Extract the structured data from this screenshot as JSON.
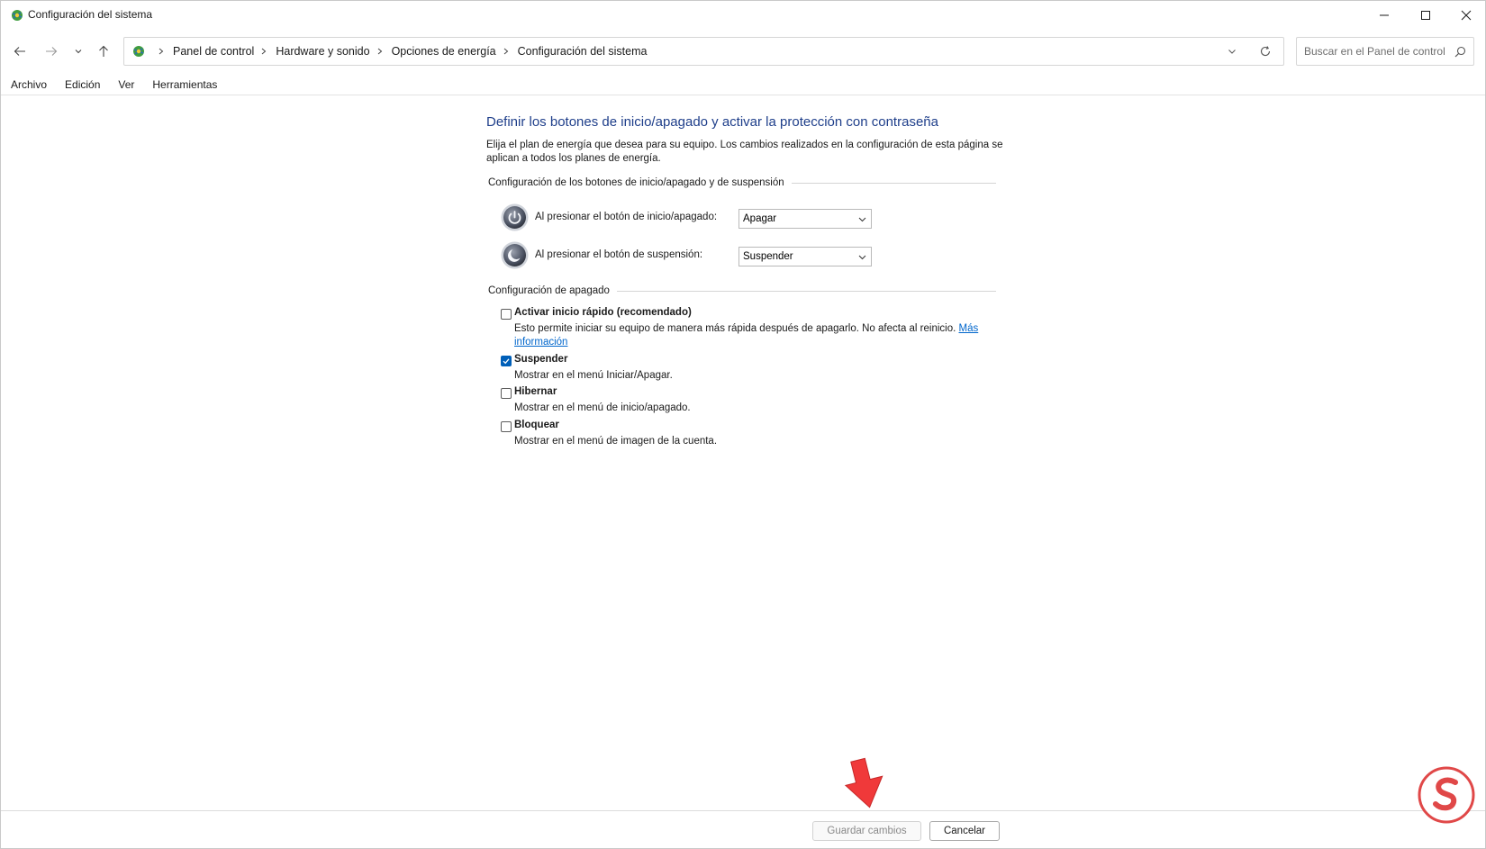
{
  "window": {
    "title": "Configuración del sistema"
  },
  "address_bar": {
    "crumbs": [
      "Panel de control",
      "Hardware y sonido",
      "Opciones de energía",
      "Configuración del sistema"
    ]
  },
  "search": {
    "placeholder": "Buscar en el Panel de control"
  },
  "menu": {
    "items": [
      "Archivo",
      "Edición",
      "Ver",
      "Herramientas"
    ]
  },
  "content": {
    "title": "Definir los botones de inicio/apagado y activar la protección con contraseña",
    "description": "Elija el plan de energía que desea para su equipo. Los cambios realizados en la configuración de esta página se aplican a todos los planes de energía.",
    "buttons_group": {
      "heading": "Configuración de los botones de inicio/apagado y de suspensión",
      "rows": [
        {
          "label": "Al presionar el botón de inicio/apagado:",
          "value": "Apagar"
        },
        {
          "label": "Al presionar el botón de suspensión:",
          "value": "Suspender"
        }
      ]
    },
    "shutdown_group": {
      "heading": "Configuración de apagado",
      "options": [
        {
          "title": "Activar inicio rápido (recomendado)",
          "description": "Esto permite iniciar su equipo de manera más rápida después de apagarlo. No afecta al reinicio.",
          "link": "Más información",
          "checked": false
        },
        {
          "title": "Suspender",
          "description": "Mostrar en el menú Iniciar/Apagar.",
          "checked": true
        },
        {
          "title": "Hibernar",
          "description": "Mostrar en el menú de inicio/apagado.",
          "checked": false
        },
        {
          "title": "Bloquear",
          "description": "Mostrar en el menú de imagen de la cuenta.",
          "checked": false
        }
      ]
    }
  },
  "footer": {
    "save_label": "Guardar cambios",
    "cancel_label": "Cancelar"
  },
  "colors": {
    "title_blue": "#1e3e8a",
    "accent": "#005fb8",
    "link": "#0066cc",
    "arrow": "#f0393a"
  },
  "icons": {
    "app": "control-panel-icon",
    "power_button": "power-icon",
    "sleep_button": "moon-icon"
  }
}
